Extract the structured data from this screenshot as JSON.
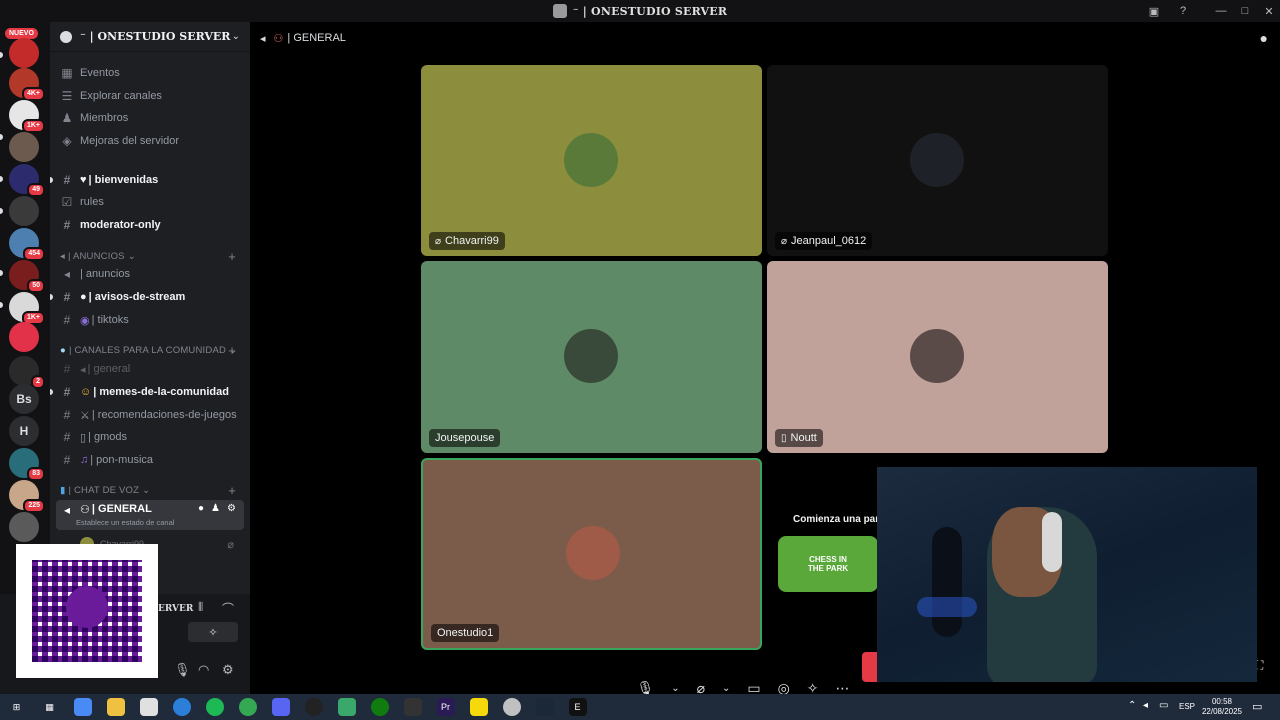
{
  "window": {
    "title": "⁻ | ONESTUDIO SERVER"
  },
  "rail": {
    "nuevo": "NUEVO",
    "badges": [
      "4K+",
      "1K+",
      "49",
      "454",
      "50",
      "1K+",
      "2",
      "83",
      "225"
    ],
    "letters": [
      "Bs",
      "H"
    ]
  },
  "sidebar": {
    "server_name": "⁻ | ONESTUDIO SERVER",
    "top_items": [
      "Eventos",
      "Explorar canales",
      "Miembros",
      "Mejoras del servidor"
    ],
    "channels1": [
      "| bienvenidas",
      "rules",
      "moderator-only"
    ],
    "cat_anuncios": "| ANUNCIOS",
    "anuncios": [
      "| anuncios",
      "| avisos-de-stream",
      "| tiktoks"
    ],
    "cat_comunidad": "| CANALES PARA LA COMUNIDAD",
    "comunidad": [
      "| general",
      "| memes-de-la-comunidad",
      "| recomendaciones-de-juegos",
      "| gmods",
      "| pon-musica"
    ],
    "cat_voz": "| CHAT DE VOZ",
    "voice_channel": "| GENERAL",
    "voice_status": "Establece un estado de canal",
    "voice_user": "Chavarri99",
    "panel_server": "ERVER"
  },
  "main": {
    "header": "| GENERAL",
    "tiles": [
      {
        "name": "Chavarri99",
        "color": "#8c8e3d"
      },
      {
        "name": "Jeanpaul_0612",
        "color": "#111111"
      },
      {
        "name": "Jousepouse",
        "color": "#5f8a67"
      },
      {
        "name": "Noutt",
        "color": "#c1a29b"
      },
      {
        "name": "Onestudio1",
        "color": "#7b5b4a"
      }
    ],
    "activity_title": "Comienza una partid",
    "activity_game": "CHESS IN THE PARK"
  },
  "taskbar": {
    "lang": "ESP",
    "time": "00:58",
    "date": "22/08/2025",
    "apps": [
      "search",
      "copilot",
      "files",
      "store",
      "edge",
      "spotify",
      "chrome",
      "discord",
      "obs",
      "files2",
      "xbox",
      "app",
      "premiere",
      "notes",
      "app2",
      "steam",
      "epic"
    ]
  },
  "colors": {
    "accent": "#5865f2",
    "danger": "#e53945",
    "speaking": "#3ba55c"
  }
}
